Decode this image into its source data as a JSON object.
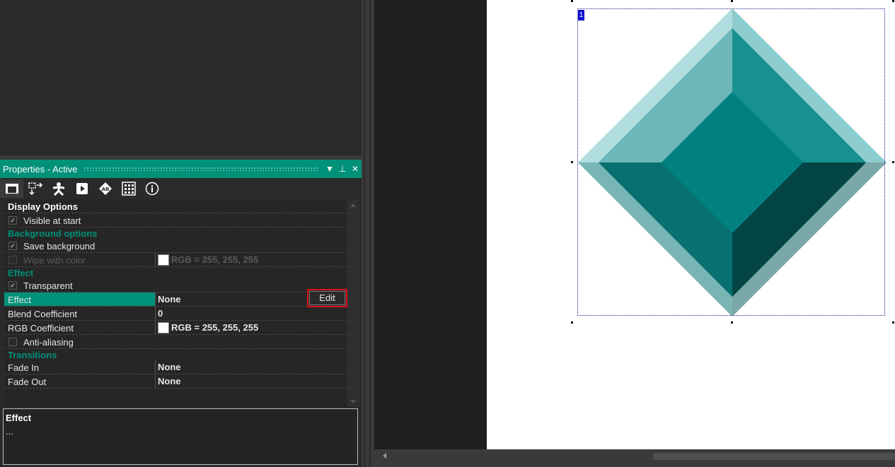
{
  "panel": {
    "title": "Properties - Active",
    "controls": {
      "dropdown": "▼",
      "pin": "⊥",
      "close": "✕"
    }
  },
  "toolbar": {
    "icons": [
      "display-icon",
      "movement-icon",
      "runtime-icon",
      "play-icon",
      "about-icon",
      "grid-icon",
      "info-icon"
    ]
  },
  "properties": {
    "display_options": "Display Options",
    "visible_at_start": "Visible at start",
    "background_options": "Background options",
    "save_background": "Save background",
    "wipe_with_color": "Wipe with color",
    "wipe_color_value": "RGB = 255, 255, 255",
    "effect_header": "Effect",
    "transparent": "Transparent",
    "effect_label": "Effect",
    "effect_value": "None",
    "edit_label": "Edit",
    "blend_label": "Blend Coefficient",
    "blend_value": "0",
    "rgb_label": "RGB Coefficient",
    "rgb_value": "RGB = 255, 255, 255",
    "antialias": "Anti-aliasing",
    "transitions": "Transitions",
    "fade_in_label": "Fade In",
    "fade_in_value": "None",
    "fade_out_label": "Fade Out",
    "fade_out_value": "None",
    "checks": {
      "visible_at_start": true,
      "save_background": true,
      "wipe_with_color": false,
      "transparent": true,
      "antialias": false
    }
  },
  "description": {
    "title": "Effect",
    "text": "..."
  },
  "canvas": {
    "object_badge": "1"
  },
  "colors": {
    "accent": "#009179",
    "edit_highlight": "#e0101a"
  }
}
